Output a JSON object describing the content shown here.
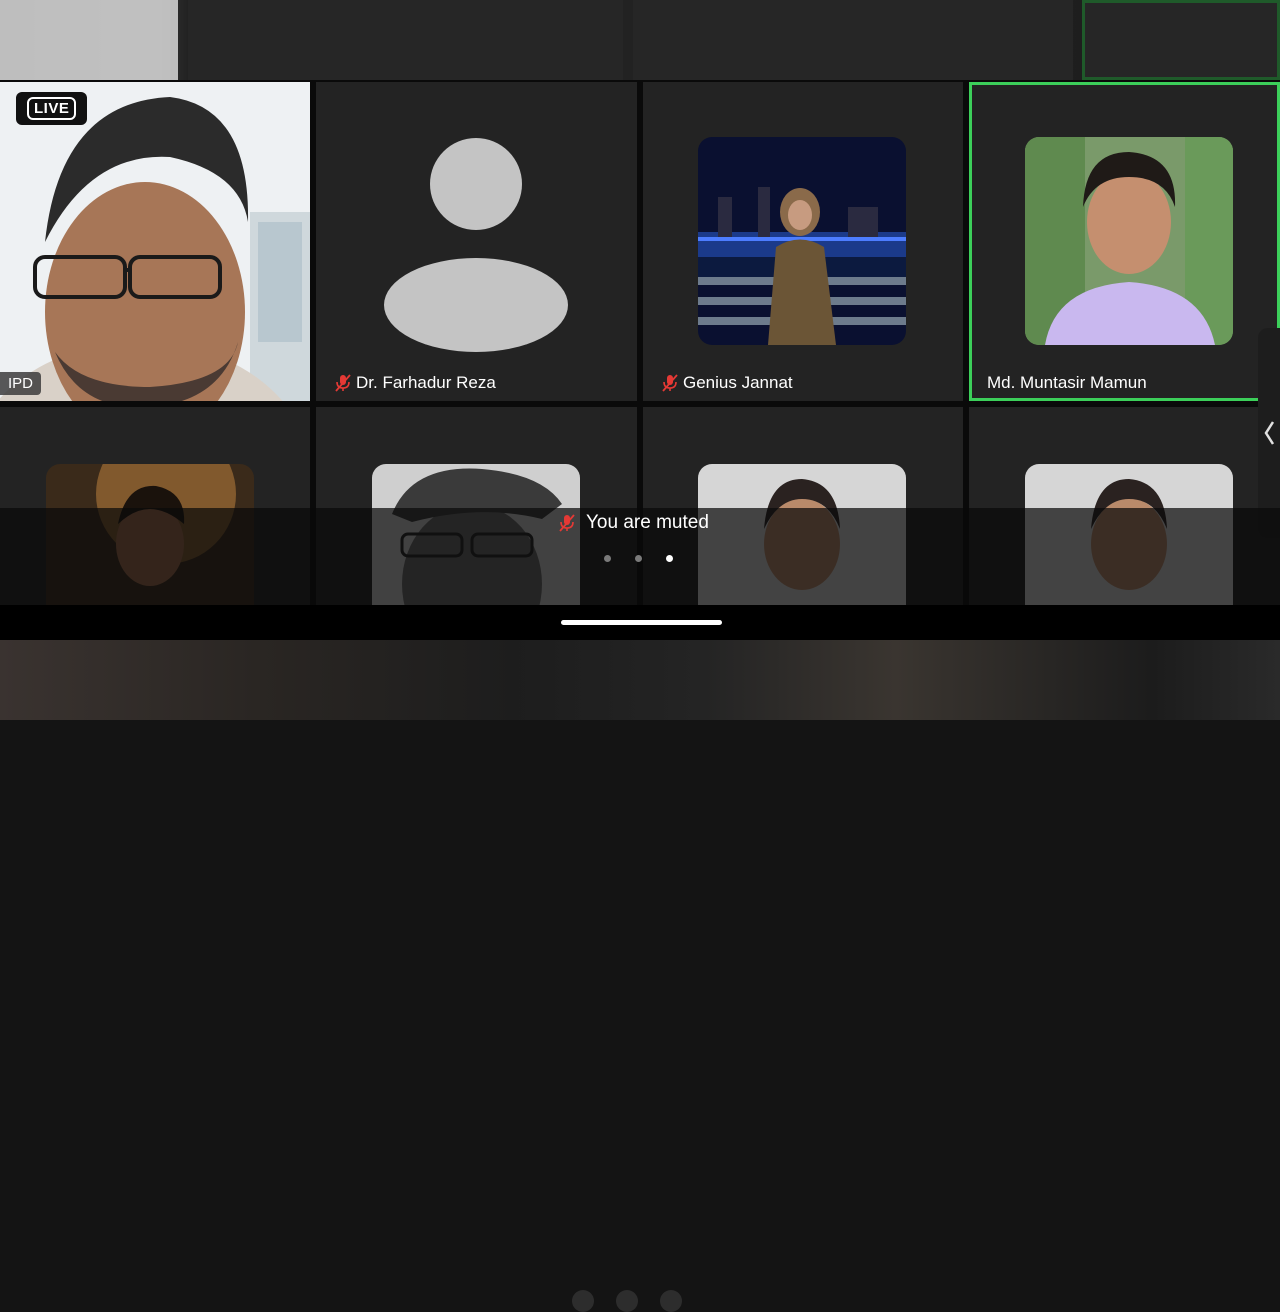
{
  "live_label": "LIVE",
  "tiles": [
    {
      "id": "ipd",
      "name": "IPD",
      "muted": false
    },
    {
      "id": "farhadur",
      "name": "Dr. Farhadur Reza",
      "muted": true
    },
    {
      "id": "genius",
      "name": "Genius Jannat",
      "muted": true
    },
    {
      "id": "muntasir",
      "name": "Md. Muntasir Mamun",
      "muted": false,
      "active_speaker": true
    },
    {
      "id": "p5",
      "name": "",
      "muted": false
    },
    {
      "id": "p6",
      "name": "",
      "muted": false
    },
    {
      "id": "p7",
      "name": "",
      "muted": false
    },
    {
      "id": "p8",
      "name": "",
      "muted": false
    }
  ],
  "toast": {
    "text": "You are muted",
    "icon": "mic-off-icon"
  },
  "pager": {
    "pages": 3,
    "current": 3
  },
  "colors": {
    "active_border": "#3ccf5a",
    "muted_icon": "#e53935",
    "tile_bg": "#232323"
  }
}
